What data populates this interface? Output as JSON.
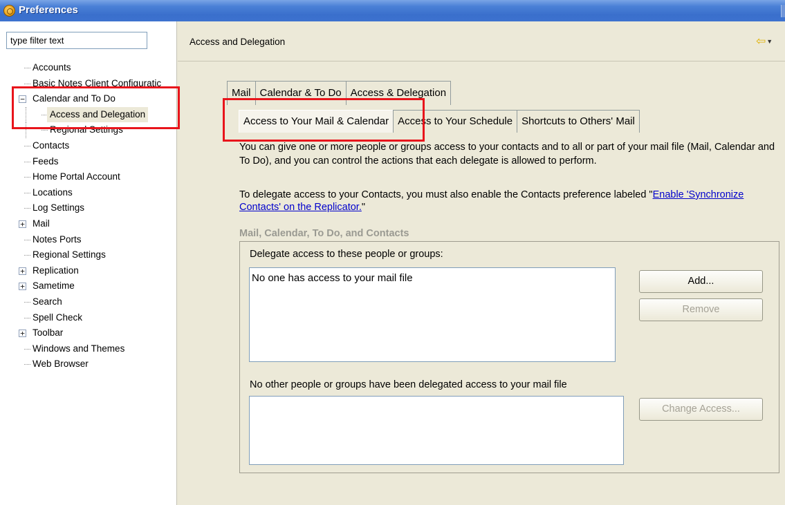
{
  "window": {
    "title": "Preferences"
  },
  "filter": {
    "placeholder": "type filter text",
    "value": "type filter text"
  },
  "tree": {
    "items": [
      {
        "label": "Accounts",
        "level": 1,
        "expander": ""
      },
      {
        "label": "Basic Notes Client Configuratic",
        "level": 1,
        "expander": ""
      },
      {
        "label": "Calendar and To Do",
        "level": 1,
        "expander": "−"
      },
      {
        "label": "Access and Delegation",
        "level": 2,
        "expander": "",
        "selected": true
      },
      {
        "label": "Regional Settings",
        "level": 2,
        "expander": ""
      },
      {
        "label": "Contacts",
        "level": 1,
        "expander": ""
      },
      {
        "label": "Feeds",
        "level": 1,
        "expander": ""
      },
      {
        "label": "Home Portal Account",
        "level": 1,
        "expander": ""
      },
      {
        "label": "Locations",
        "level": 1,
        "expander": ""
      },
      {
        "label": "Log Settings",
        "level": 1,
        "expander": ""
      },
      {
        "label": "Mail",
        "level": 1,
        "expander": "+"
      },
      {
        "label": "Notes Ports",
        "level": 1,
        "expander": ""
      },
      {
        "label": "Regional Settings",
        "level": 1,
        "expander": ""
      },
      {
        "label": "Replication",
        "level": 1,
        "expander": "+"
      },
      {
        "label": "Sametime",
        "level": 1,
        "expander": "+"
      },
      {
        "label": "Search",
        "level": 1,
        "expander": ""
      },
      {
        "label": "Spell Check",
        "level": 1,
        "expander": ""
      },
      {
        "label": "Toolbar",
        "level": 1,
        "expander": "+"
      },
      {
        "label": "Windows and Themes",
        "level": 1,
        "expander": ""
      },
      {
        "label": "Web Browser",
        "level": 1,
        "expander": ""
      }
    ]
  },
  "header": {
    "title": "Access and Delegation",
    "back_icon": "back-arrow-icon"
  },
  "tabs": [
    "Mail",
    "Calendar & To Do",
    "Access & Delegation"
  ],
  "subtabs": [
    "Access to Your Mail & Calendar",
    "Access to Your Schedule",
    "Shortcuts to Others' Mail"
  ],
  "description": {
    "para1": "You can give one or more people or groups access to your contacts and to all or part of your mail file (Mail, Calendar and To Do), and you can control the actions that each delegate is allowed to perform.",
    "para2_prefix": "To delegate access to your Contacts, you must also enable the Contacts preference labeled \"",
    "para2_link": "Enable 'Synchronize Contacts' on the Replicator.",
    "para2_suffix": "\""
  },
  "group": {
    "title": "Mail, Calendar, To Do, and Contacts",
    "delegate_label": "Delegate access to these people or groups:",
    "delegate_list_text": "No one has access to your mail file",
    "other_label": "No other people or groups have been delegated access to your mail file",
    "add_button": "Add...",
    "remove_button": "Remove",
    "change_access_button": "Change Access..."
  },
  "colors": {
    "highlight": "#e8141b",
    "titlebar": "#3a6fcc",
    "link": "#0000cc"
  }
}
